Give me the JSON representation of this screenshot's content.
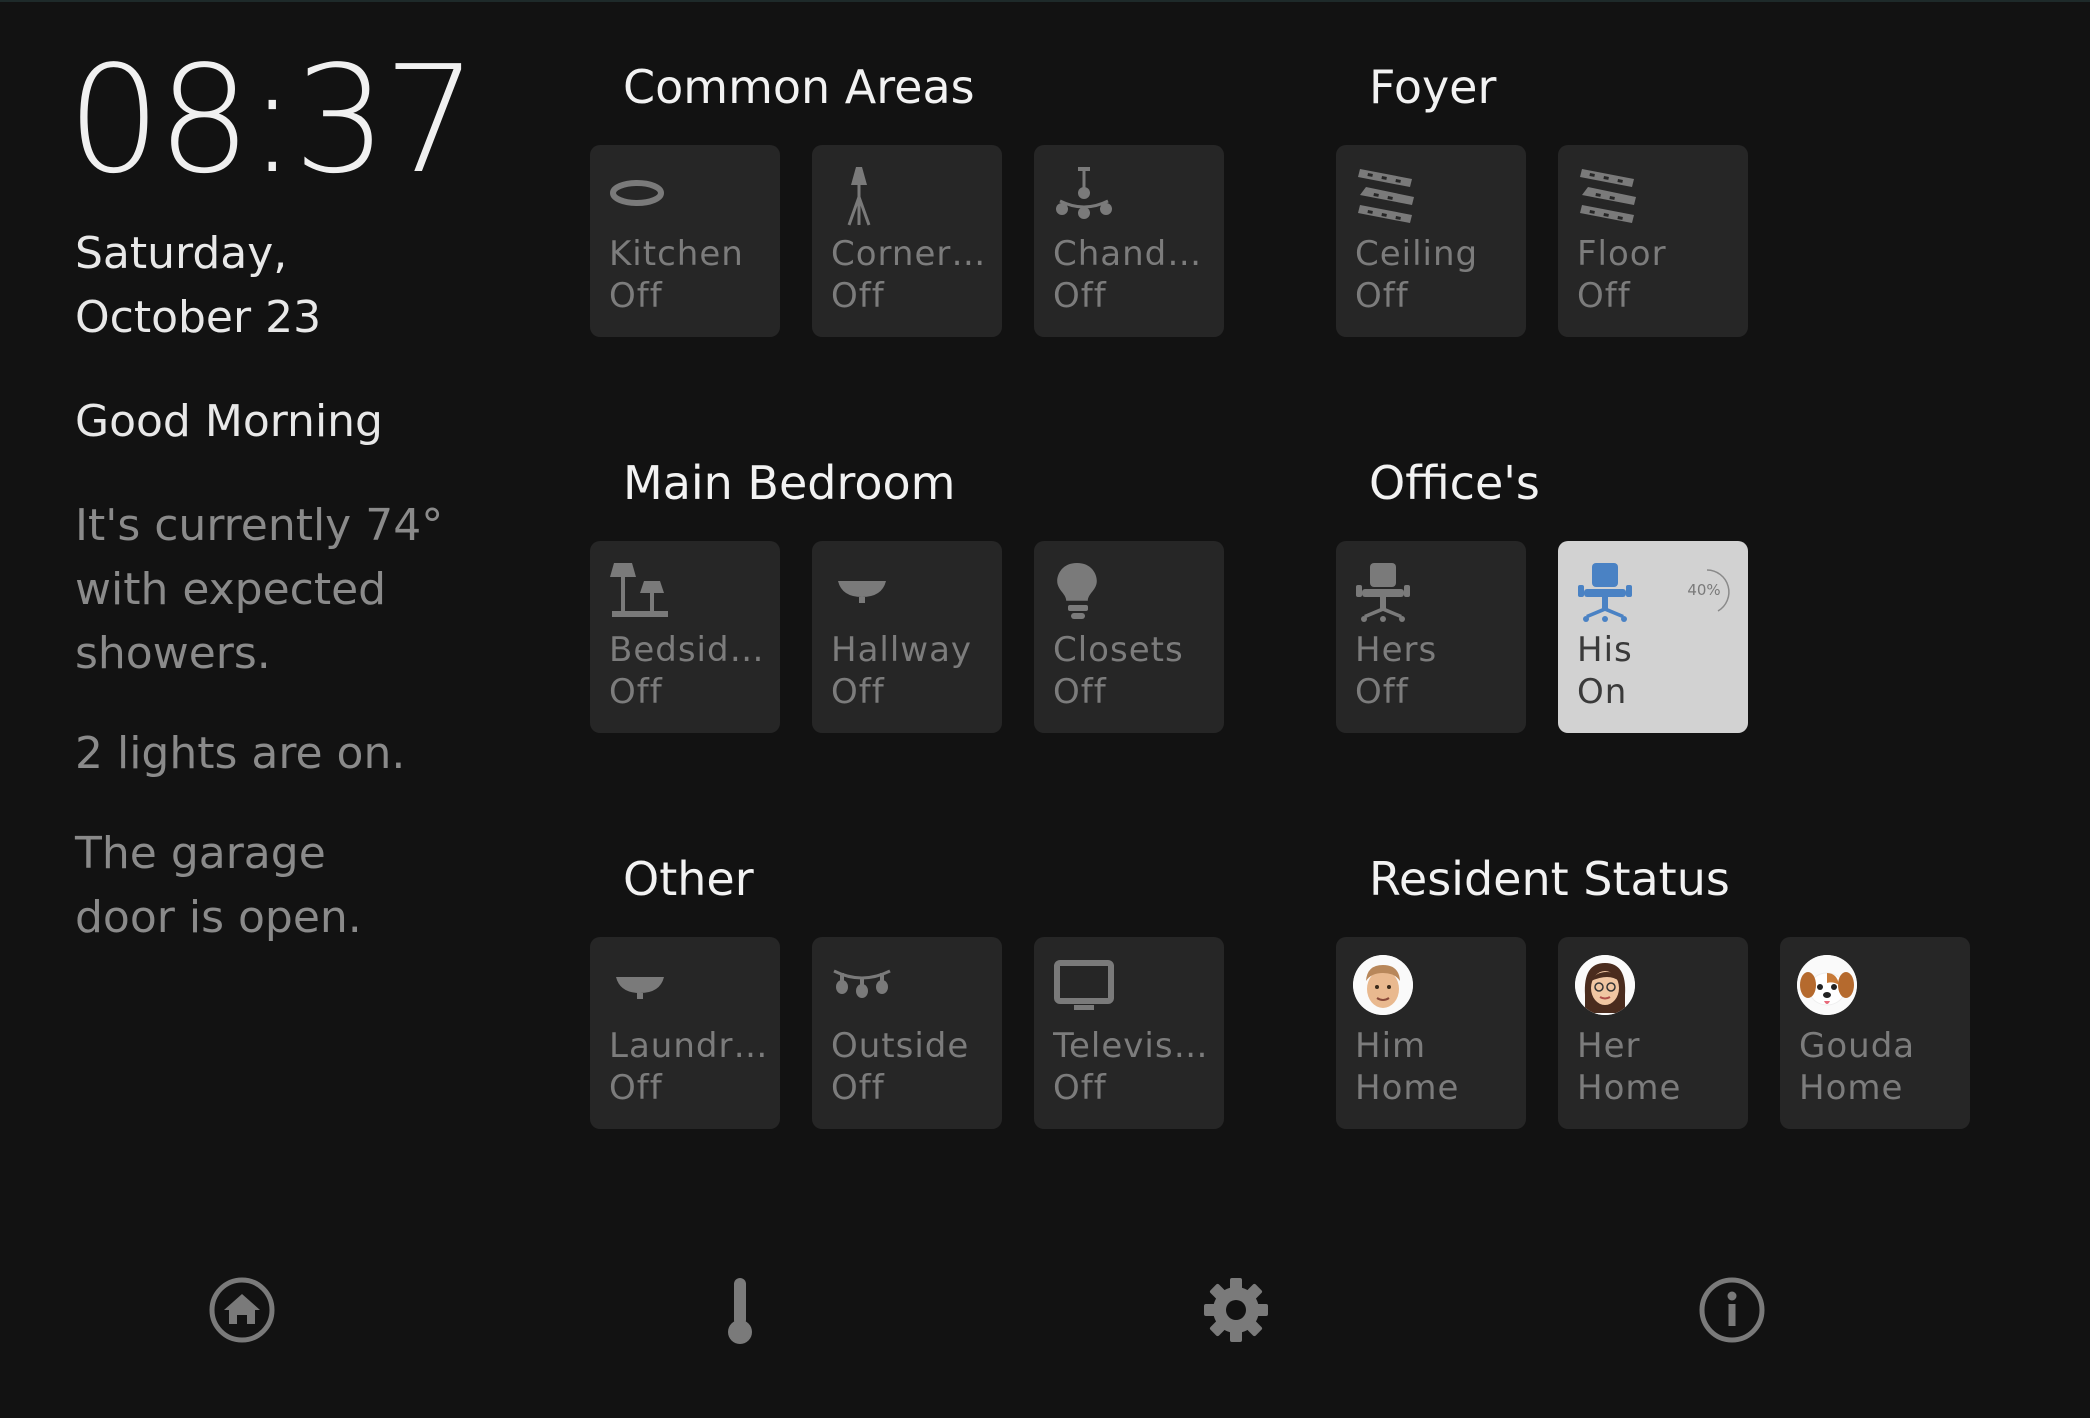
{
  "clock": "08:37",
  "date": "Saturday, October 23",
  "greeting": "Good Morning",
  "weather": "It's currently 74° with expected showers.",
  "lights_summary": "2 lights are on.",
  "garage": "The garage door is open.",
  "colors": {
    "background": "#121212",
    "tile": "#262626",
    "tile_on": "#d2d2d2",
    "accent": "#4a82c4",
    "muted": "#7c7c7c"
  },
  "sections": {
    "common": {
      "title": "Common Areas",
      "tiles": [
        {
          "name": "Kitchen",
          "state": "Off",
          "icon": "ceiling-light-icon"
        },
        {
          "name": "Corner ...",
          "state": "Off",
          "icon": "floor-lamp-icon"
        },
        {
          "name": "Chandel...",
          "state": "Off",
          "icon": "chandelier-icon"
        }
      ]
    },
    "foyer": {
      "title": "Foyer",
      "tiles": [
        {
          "name": "Ceiling",
          "state": "Off",
          "icon": "led-strip-icon"
        },
        {
          "name": "Floor",
          "state": "Off",
          "icon": "led-strip-icon"
        }
      ]
    },
    "bedroom": {
      "title": "Main Bedroom",
      "tiles": [
        {
          "name": "Bedside...",
          "state": "Off",
          "icon": "table-lamps-icon"
        },
        {
          "name": "Hallway",
          "state": "Off",
          "icon": "ceiling-fixture-icon"
        },
        {
          "name": "Closets",
          "state": "Off",
          "icon": "lightbulb-icon"
        }
      ]
    },
    "offices": {
      "title": "Office's",
      "tiles": [
        {
          "name": "Hers",
          "state": "Off",
          "icon": "office-chair-icon"
        },
        {
          "name": "His",
          "state": "On",
          "icon": "office-chair-icon",
          "brightness": "40%",
          "brightness_value": 0.4
        }
      ]
    },
    "other": {
      "title": "Other",
      "tiles": [
        {
          "name": "Laundry...",
          "state": "Off",
          "icon": "ceiling-fixture-icon"
        },
        {
          "name": "Outside",
          "state": "Off",
          "icon": "string-lights-icon"
        },
        {
          "name": "Televisi...",
          "state": "Off",
          "icon": "television-icon"
        }
      ]
    },
    "residents": {
      "title": "Resident Status",
      "tiles": [
        {
          "name": "Him",
          "state": "Home",
          "icon": "man-avatar"
        },
        {
          "name": "Her",
          "state": "Home",
          "icon": "woman-avatar"
        },
        {
          "name": "Gouda",
          "state": "Home",
          "icon": "dog-avatar"
        }
      ]
    }
  },
  "nav": [
    "home-icon",
    "thermometer-icon",
    "gear-icon",
    "info-icon"
  ]
}
